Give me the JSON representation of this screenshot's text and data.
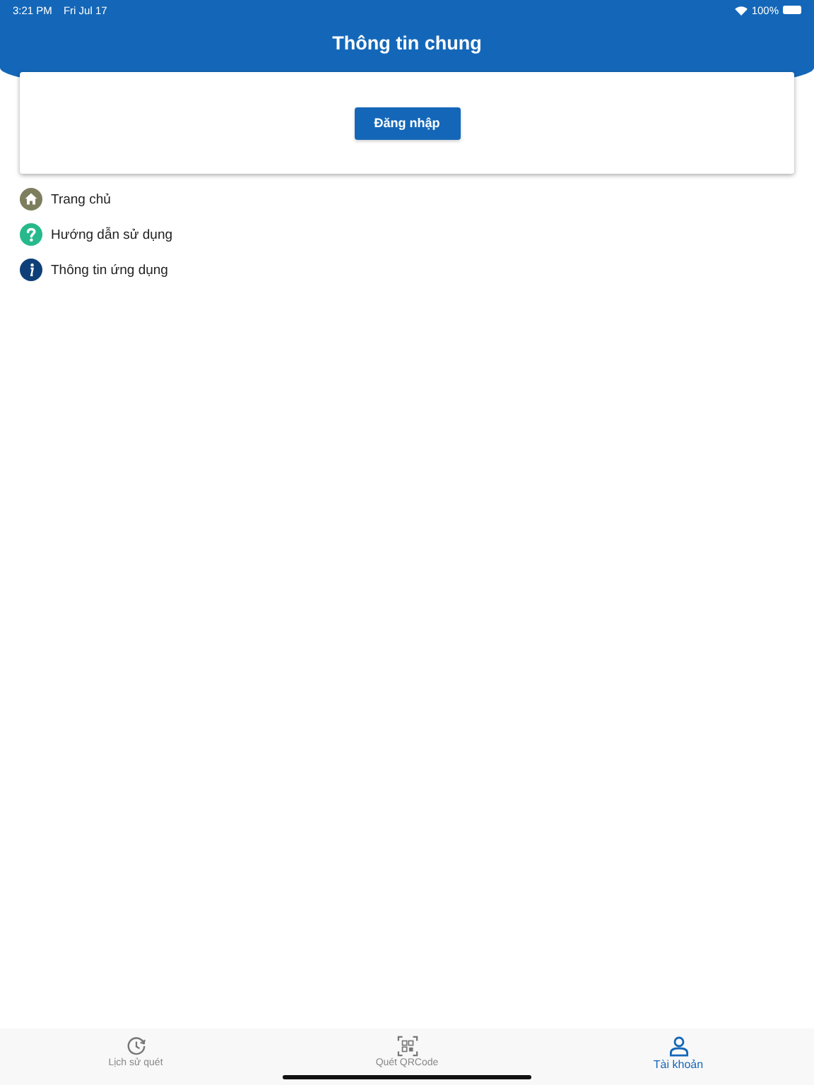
{
  "status_bar": {
    "time": "3:21 PM",
    "date": "Fri Jul 17",
    "battery": "100%"
  },
  "header": {
    "title": "Thông tin chung"
  },
  "card": {
    "button": "Đăng nhập"
  },
  "menu": [
    {
      "kind": "home",
      "label": "Trang chủ"
    },
    {
      "kind": "help",
      "label": "Hướng dẫn sử dụng"
    },
    {
      "kind": "info",
      "label": "Thông tin ứng dụng"
    }
  ],
  "tabs": [
    {
      "kind": "history",
      "label": "Lịch sử quét",
      "selected": false
    },
    {
      "kind": "qr",
      "label": "Quét QRCode",
      "selected": false
    },
    {
      "kind": "account",
      "label": "Tài khoản",
      "selected": true
    }
  ]
}
